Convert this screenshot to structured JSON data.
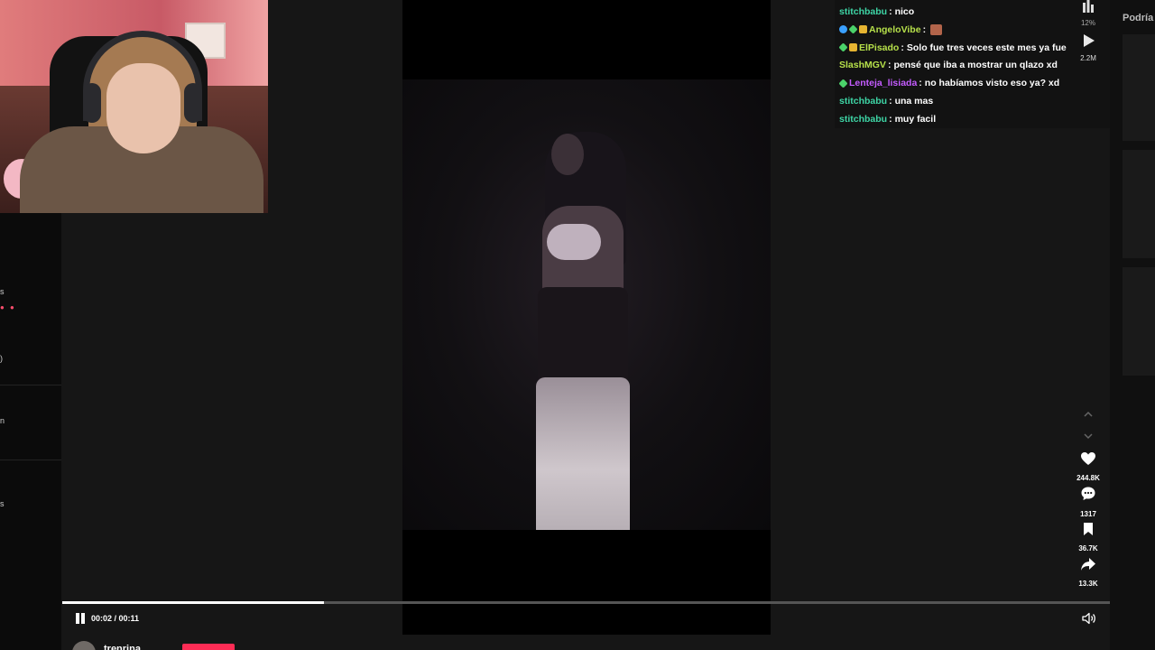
{
  "webcam": {
    "label": ""
  },
  "left_sidebar": {
    "fragments": [
      "s",
      ")",
      "n",
      "s"
    ],
    "dots": "● ●"
  },
  "chat": {
    "top_badge": "12%",
    "top_views": "2.2M",
    "messages": [
      {
        "user": "stitchbabu",
        "user_color": "#3ed6a6",
        "badges": [],
        "text": "nico",
        "emote": false
      },
      {
        "user": "AngeloVibe",
        "user_color": "#b6e04a",
        "badges": [
          "blue",
          "green",
          "gold"
        ],
        "text": "",
        "emote": true
      },
      {
        "user": "ElPisado",
        "user_color": "#b6e04a",
        "badges": [
          "green",
          "gold"
        ],
        "text": "Solo fue tres veces este mes ya fue",
        "emote": false
      },
      {
        "user": "SlashMGV",
        "user_color": "#b6e04a",
        "badges": [],
        "text": "pensé que iba a mostrar un qlazo xd",
        "emote": false
      },
      {
        "user": "Lenteja_lisiada",
        "user_color": "#c45cff",
        "badges": [
          "green"
        ],
        "text": "no habíamos visto eso ya? xd",
        "emote": false
      },
      {
        "user": "stitchbabu",
        "user_color": "#3ed6a6",
        "badges": [],
        "text": "una mas",
        "emote": false
      },
      {
        "user": "stitchbabu",
        "user_color": "#3ed6a6",
        "badges": [],
        "text": "muy facil",
        "emote": false
      }
    ]
  },
  "actions": {
    "likes": "244.8K",
    "comments": "1317",
    "saves": "36.7K",
    "shares": "13.3K"
  },
  "far_right": {
    "title": "Podría"
  },
  "player": {
    "time": "00:02 / 00:11",
    "progress": 0.25
  },
  "author": {
    "username": "trenrina"
  },
  "colors": {
    "accent": "#fe2c55",
    "background": "#161616"
  }
}
